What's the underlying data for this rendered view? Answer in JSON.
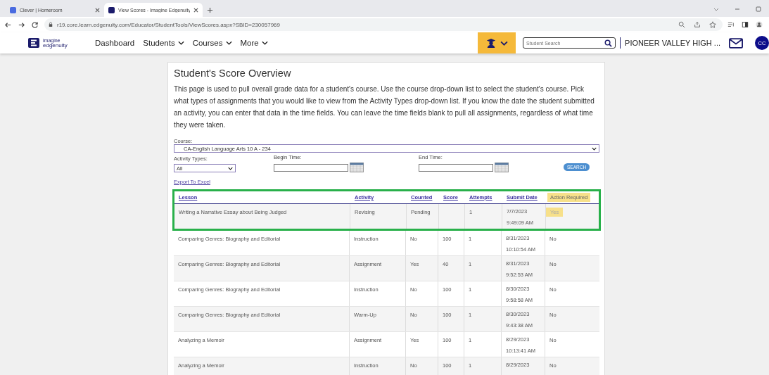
{
  "browser": {
    "tabs": [
      {
        "title": "Clever | Homeroom",
        "selected": false
      },
      {
        "title": "View Scores - Imagine Edgenuity",
        "selected": true
      }
    ],
    "url": "r19.core.learn.edgenuity.com/Educator/StudentTools/ViewScores.aspx?SBID=230057969"
  },
  "nav": {
    "logo_top": "imagine",
    "logo_bottom": "edgenuity",
    "items": [
      {
        "label": "Dashboard",
        "dropdown": false
      },
      {
        "label": "Students",
        "dropdown": true
      },
      {
        "label": "Courses",
        "dropdown": true
      },
      {
        "label": "More",
        "dropdown": true
      }
    ],
    "search": {
      "placeholder": "Student Search"
    },
    "school": "PIONEER VALLEY HIGH ...",
    "avatar": "CC"
  },
  "page": {
    "title": "Student's Score Overview",
    "description": "This page is used to pull overall grade data for a student's course. Use the course drop-down list to select the student's course. Pick what types of assignments that you would like to view from the Activity Types drop-down list. If you know the date the student submitted an activity, you can enter that data in the time fields. You can leave the time fields blank to pull all assignments, regardless of what time they were taken.",
    "course_label": "Course:",
    "course": "CA-English Language Arts 10 A - 234",
    "activity_label": "Activity Types:",
    "activity": "All",
    "begin_label": "Begin Time:",
    "end_label": "End Time:",
    "search_button": "SEARCH",
    "export": "Export To Excel"
  },
  "table": {
    "columns": [
      {
        "label": "Lesson",
        "link": true,
        "highlighted": false
      },
      {
        "label": "Activity",
        "link": true,
        "highlighted": false
      },
      {
        "label": "Counted",
        "link": true,
        "highlighted": false
      },
      {
        "label": "Score",
        "link": true,
        "highlighted": false
      },
      {
        "label": "Attempts",
        "link": true,
        "highlighted": false
      },
      {
        "label": "Submit Date",
        "link": true,
        "highlighted": false
      },
      {
        "label": "Action Required",
        "link": false,
        "highlighted": true
      }
    ],
    "rows": [
      {
        "cells": [
          "Writing a Narrative Essay about Being Judged",
          "Revising",
          "Pending",
          "",
          "1",
          "7/7/2023 9:49:09 AM",
          "Yes"
        ],
        "highlighted": true,
        "action_flagged": true
      },
      {
        "cells": [
          "Comparing Genres: Biography and Editorial",
          "Instruction",
          "No",
          "100",
          "1",
          "8/31/2023 10:10:54 AM",
          "No"
        ],
        "highlighted": false,
        "action_flagged": false
      },
      {
        "cells": [
          "Comparing Genres: Biography and Editorial",
          "Assignment",
          "Yes",
          "40",
          "1",
          "8/31/2023 9:52:53 AM",
          "No"
        ],
        "highlighted": false,
        "action_flagged": false
      },
      {
        "cells": [
          "Comparing Genres: Biography and Editorial",
          "Instruction",
          "No",
          "100",
          "1",
          "8/30/2023 9:58:58 AM",
          "No"
        ],
        "highlighted": false,
        "action_flagged": false
      },
      {
        "cells": [
          "Comparing Genres: Biography and Editorial",
          "Warm-Up",
          "No",
          "100",
          "1",
          "8/30/2023 9:43:38 AM",
          "No"
        ],
        "highlighted": false,
        "action_flagged": false
      },
      {
        "cells": [
          "Analyzing a Memoir",
          "Assignment",
          "Yes",
          "100",
          "1",
          "8/29/2023 10:13:41 AM",
          "No"
        ],
        "highlighted": false,
        "action_flagged": false
      },
      {
        "cells": [
          "Analyzing a Memoir",
          "Instruction",
          "No",
          "100",
          "1",
          "8/29/2023",
          "No"
        ],
        "highlighted": false,
        "action_flagged": false
      }
    ]
  }
}
